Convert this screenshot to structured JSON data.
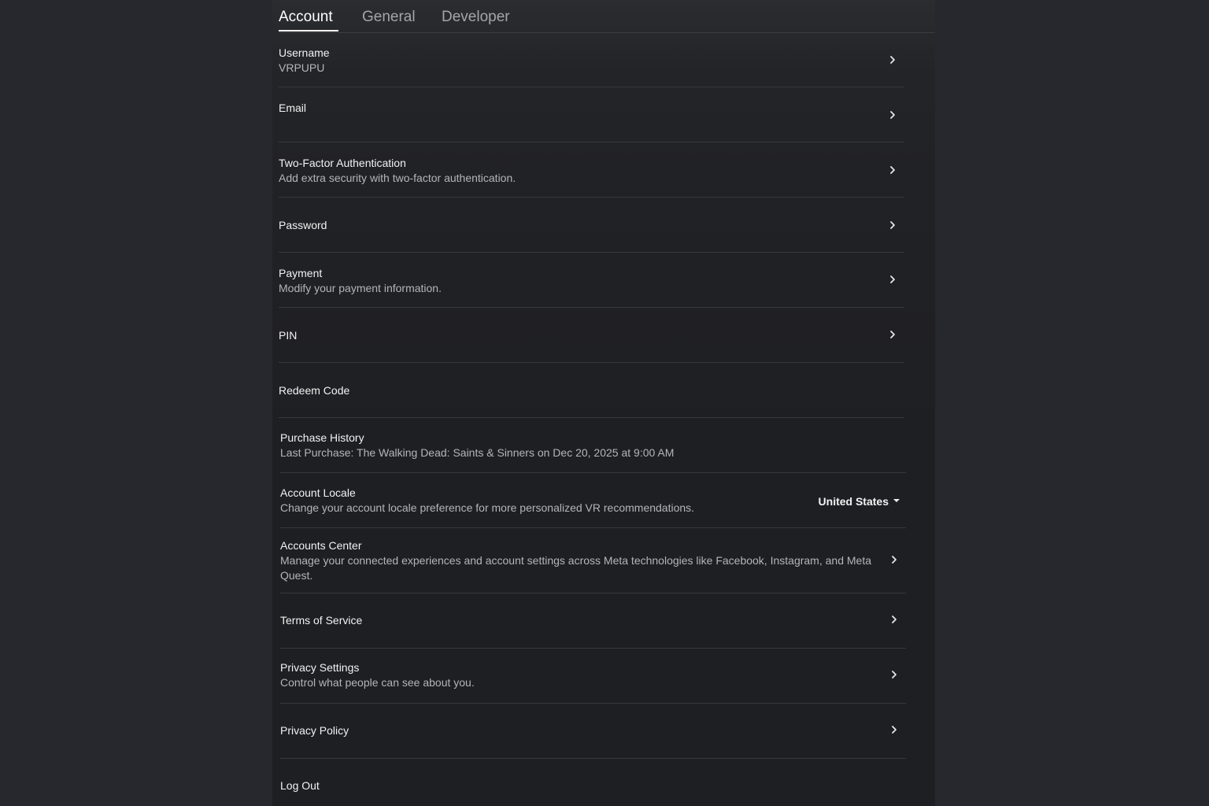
{
  "tabs": [
    {
      "label": "Account"
    },
    {
      "label": "General"
    },
    {
      "label": "Developer"
    }
  ],
  "rows": {
    "username": {
      "title": "Username",
      "value": "VRPUPU"
    },
    "email": {
      "title": "Email"
    },
    "two_factor": {
      "title": "Two-Factor Authentication",
      "subtitle": "Add extra security with two-factor authentication."
    },
    "password": {
      "title": "Password"
    },
    "payment": {
      "title": "Payment",
      "subtitle": "Modify your payment information."
    },
    "pin": {
      "title": "PIN"
    },
    "redeem": {
      "title": "Redeem Code"
    },
    "purchase_history": {
      "title": "Purchase History",
      "subtitle": "Last Purchase: The Walking Dead: Saints & Sinners on Dec 20, 2025 at 9:00 AM"
    },
    "account_locale": {
      "title": "Account Locale",
      "subtitle": "Change your account locale preference for more personalized VR recommendations.",
      "selected": "United States"
    },
    "accounts_center": {
      "title": "Accounts Center",
      "subtitle": "Manage your connected experiences and account settings across Meta technologies like Facebook, Instagram, and Meta Quest."
    },
    "terms": {
      "title": "Terms of Service"
    },
    "privacy_settings": {
      "title": "Privacy Settings",
      "subtitle": "Control what people can see about you."
    },
    "privacy_policy": {
      "title": "Privacy Policy"
    },
    "logout": {
      "title": "Log Out"
    }
  },
  "icons": {
    "row_arrow": "chevron-right-icon",
    "dropdown": "caret-down-icon"
  },
  "colors": {
    "background": "#25272c",
    "panel": "#1e1f22",
    "text": "#f2f2f3",
    "muted": "#b3b5ba",
    "divider": "#37383c"
  }
}
